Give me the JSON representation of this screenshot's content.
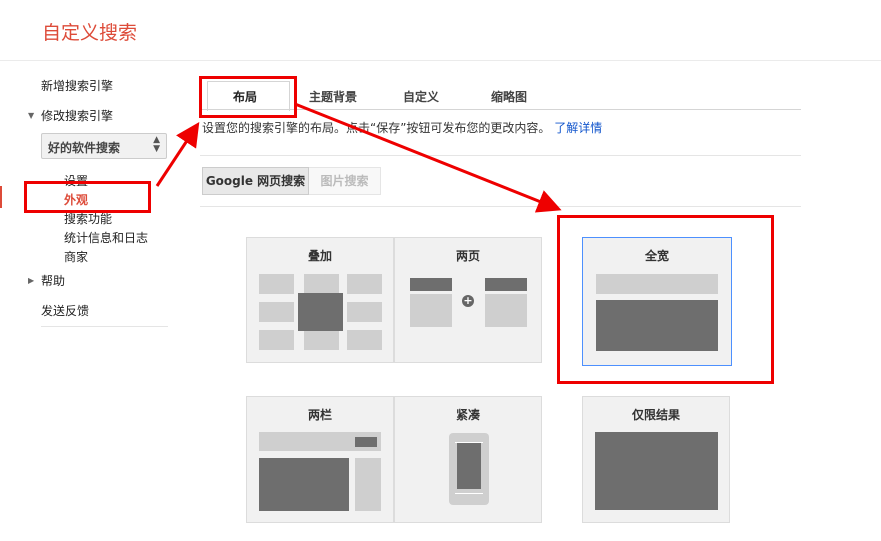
{
  "header": {
    "title": "自定义搜索"
  },
  "sidebar": {
    "items": [
      {
        "label": "新增搜索引擎"
      },
      {
        "label": "修改搜索引擎",
        "expanded": true
      },
      {
        "label": "帮助",
        "expanded": false
      },
      {
        "label": "发送反馈"
      }
    ],
    "engine_select": {
      "value": "好的软件搜索"
    },
    "sub_items": [
      {
        "label": "设置"
      },
      {
        "label": "外观",
        "active": true
      },
      {
        "label": "搜索功能"
      },
      {
        "label": "统计信息和日志"
      },
      {
        "label": "商家"
      }
    ]
  },
  "tabs": [
    {
      "label": "布局",
      "active": true
    },
    {
      "label": "主题背景"
    },
    {
      "label": "自定义"
    },
    {
      "label": "缩略图"
    }
  ],
  "description": {
    "text": "设置您的搜索引擎的布局。点击“保存”按钮可发布您的更改内容。",
    "link": "了解详情"
  },
  "search_type": {
    "options": [
      {
        "label": "Google 网页搜索",
        "selected": true
      },
      {
        "label": "图片搜索",
        "selected": false
      }
    ]
  },
  "layouts": [
    {
      "label": "叠加"
    },
    {
      "label": "两页"
    },
    {
      "label": "全宽",
      "selected": true
    },
    {
      "label": "两栏"
    },
    {
      "label": "紧凑"
    },
    {
      "label": "仅限结果"
    }
  ],
  "colors": {
    "brand_title": "#dd4b39",
    "link": "#1155cc",
    "annotation": "#ee0000",
    "selected_border": "#4d90fe"
  }
}
